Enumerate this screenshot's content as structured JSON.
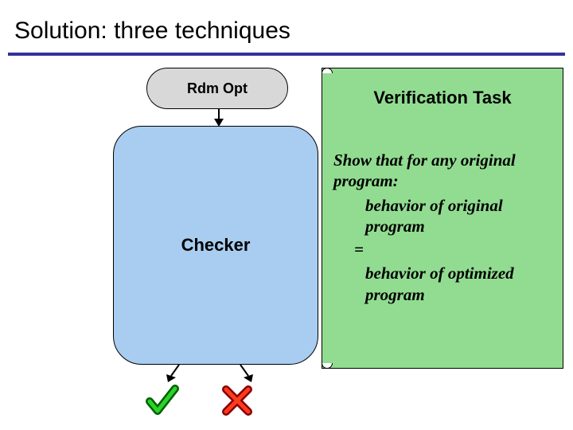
{
  "title": "Solution: three techniques",
  "rdm_label": "Rdm Opt",
  "checker_label": "Checker",
  "verification": {
    "heading": "Verification Task",
    "intro": "Show that for any original program:",
    "line1": "behavior of original program",
    "eq": "=",
    "line2": "behavior of optimized program"
  },
  "icons": {
    "check": "check-icon",
    "cross": "cross-icon"
  }
}
